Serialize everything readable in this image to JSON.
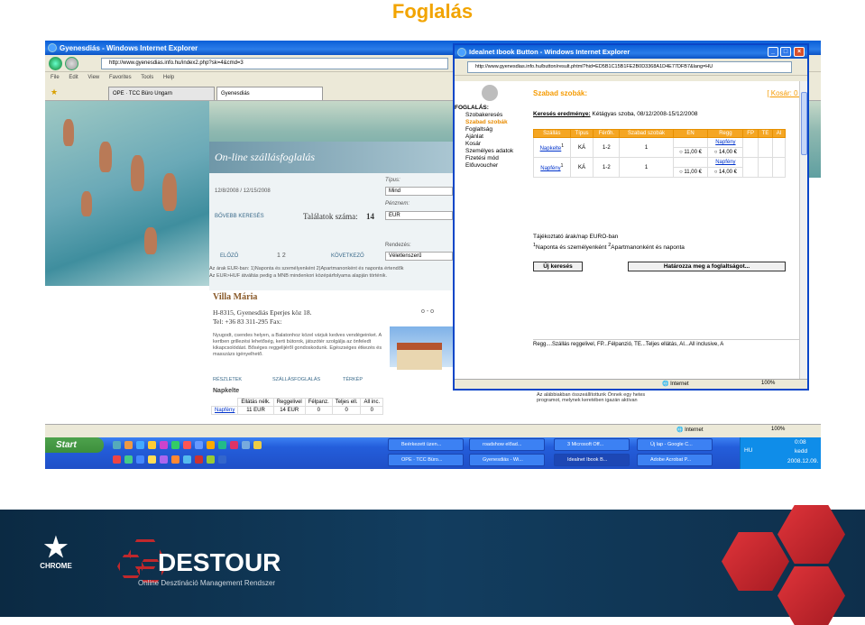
{
  "slide_title": "Foglalás",
  "back_window": {
    "title": "Gyenesdiás - Windows Internet Explorer",
    "url": "http://www.gyenesdias.info.hu/index2.php?sk=4&cmd=3",
    "menu": [
      "File",
      "Edit",
      "View",
      "Favorites",
      "Tools",
      "Help"
    ],
    "tabs": [
      "OPE · TCC Büro Ungarn",
      "Gyenesdiás"
    ],
    "panel_title": "On-line szállásfoglalás",
    "dates": "12/8/2008 / 12/15/2008",
    "tipus_label": "Típus:",
    "tipus_value": "Mind",
    "penznem_label": "Pénznem:",
    "penznem_value": "EUR",
    "bovebb": "BŐVEBB KERESÉS",
    "talalatok_label": "Találatok száma:",
    "talalatok_value": "14",
    "rendezes_label": "Rendezés:",
    "rendezes_value": "Véletlenszerű",
    "elozo": "ELŐZŐ",
    "pages": "1  2",
    "kovetkezo": "KÖVETKEZŐ",
    "note1": "Az árak EUR-ban: 1)Naponta és személyenként 2)Apartmanonként és naponta értendők",
    "note2": "Az EUR>HUF átváltás pedig a MNB mindenkori középárfolyama alapján történik.",
    "villa_name": "Villa Mária",
    "villa_addr": "H-8315, Gyenesdiás Eperjes köz 18.",
    "villa_tel": "Tel: +36 83 311-295 Fax:",
    "villa_stars": "o - o",
    "villa_desc": "Nyugodt, csendes helyen, a Balatonhoz közel várjuk kedves vendégeinket. A kertben grillezési lehetőség, kerti bútorok, játszótér szolgálja az önfeledt kikapcsolódást. Bőséges reggelijéről gondoskodunk. Egészséges étkezés és masszázs igényelhető.",
    "links": [
      "RÉSZLETEK",
      "SZÁLLÁSFOGLALÁS",
      "TÉRKÉP"
    ],
    "napkelte": "Napkelte",
    "tk_headers": [
      "Ellátás nélk.",
      "Reggelivel",
      "Félpanz.",
      "Teljes ell.",
      "All inc."
    ],
    "tk_row": [
      "Napfény",
      "11 EUR",
      "14 EUR",
      "0",
      "0",
      "0"
    ],
    "adv_text": "Az alábbiakban összeállítottunk Önnek egy hetes programot, melynek keretében igazán aktívan",
    "status_zone": "Internet",
    "zoom": "100%"
  },
  "front_window": {
    "title": "Idealnet Ibook Button - Windows Internet Explorer",
    "url": "http://www.gyenesdias.info.hu/button/result.phtml?hid=ED5B1C15B1FE2B0D3368A1D4E77DFB7&lang=HU",
    "nav_head": "FOGLALÁS:",
    "nav": [
      "Szobakeresés",
      "Szabad szobák",
      "Foglaltság",
      "Ajánlat",
      "Kosár",
      "Személyes adatok",
      "Fizetési mód",
      "Előuvoucher"
    ],
    "section_title": "Szabad szobák:",
    "kosar": "[ Kosár: 0 ]",
    "result_label": "Keresés eredménye:",
    "result_text": "Kétágyas szoba, 08/12/2008-15/12/2008",
    "headers": [
      "Szállás",
      "Típus",
      "Férőh.",
      "Szabad szobák",
      "EN",
      "Regg",
      "FP",
      "TE",
      "AI"
    ],
    "rows": [
      {
        "name": "Napkelte",
        "sup": "1",
        "tipus": "KÁ",
        "ferohely": "1-2",
        "szabad": "1",
        "en": "11,00 €",
        "regg_name": "Napfény",
        "regg": "14,00 €",
        "fp": "-",
        "te": "-",
        "ai": "-"
      },
      {
        "name": "Napfény",
        "sup": "1",
        "tipus": "KÁ",
        "ferohely": "1-2",
        "szabad": "1",
        "en": "11,00 €",
        "regg_name": "Napfény",
        "regg": "14,00 €",
        "fp": "-",
        "te": "-",
        "ai": "-"
      }
    ],
    "info1": "Tájékoztató árak/nap EURO-ban",
    "info2_pre": "Naponta és személyenként",
    "info2_post": "Apartmanonként és naponta",
    "btn_new": "Új keresés",
    "btn_book": "Határozza meg a foglaltságot...",
    "legend": "Regg....Szállás reggelivel, FP...Félpanzió, TE...Teljes ellátás, AI...All inclusive, A",
    "status_zone": "Internet",
    "zoom": "100%"
  },
  "taskbar": {
    "start": "Start",
    "row1": [
      "Beérkezett üzen...",
      "roadshow előad...",
      "3 Microsoft Off...",
      "Új lap - Google C..."
    ],
    "row2": [
      "OPE · TCC Büro...",
      "Gyenesdiás - Wi...",
      "Idealnet Ibook B...",
      "Adobe Acrobat P..."
    ],
    "lang": "HU",
    "time": "0:08",
    "day": "kedd",
    "date": "2008.12.09."
  },
  "banner": {
    "chrome": "CHROME",
    "destour": "DESTOUR",
    "sub": "Online Desztináció Management Rendszer"
  }
}
